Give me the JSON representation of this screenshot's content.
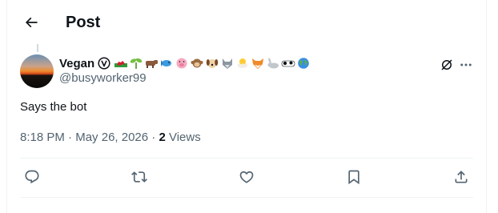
{
  "header": {
    "title": "Post",
    "back_icon": "arrow-left-icon"
  },
  "author": {
    "display_name": "Vegan",
    "handle": "@busyworker99",
    "badge_icon": "vegan-v-icon",
    "emojis": [
      "wales-flag",
      "seedling",
      "cow",
      "fish",
      "pig-face",
      "monkey",
      "dog-face",
      "wolf-face",
      "hatching-chick",
      "fox-face",
      "rabbit",
      "cow-face",
      "globe-earth"
    ]
  },
  "post": {
    "text": "Says the bot",
    "time": "8:18 PM",
    "separator": "·",
    "date": "May 26, 2026",
    "views_count": "2",
    "views_label": "Views"
  },
  "actions": [
    "reply-icon",
    "repost-icon",
    "like-icon",
    "bookmark-icon",
    "share-icon"
  ],
  "colors": {
    "text_primary": "#0f1419",
    "text_secondary": "#536471",
    "border": "#eff3f4"
  }
}
